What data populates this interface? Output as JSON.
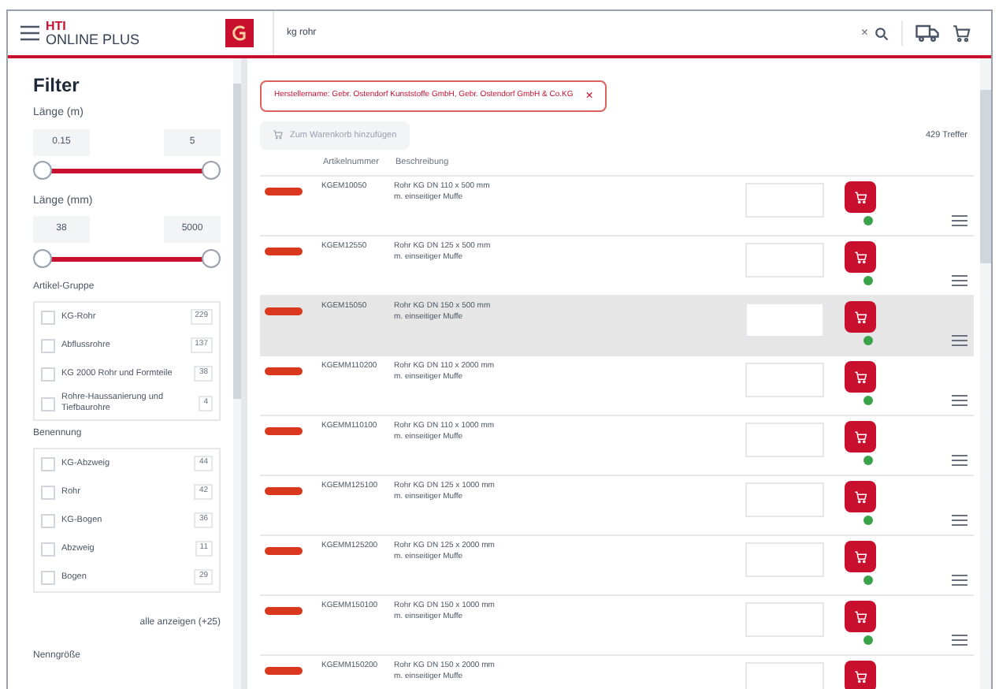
{
  "header": {
    "logo_top": "HTI",
    "logo_bottom": "ONLINE PLUS",
    "search_value": "kg rohr",
    "clear": "×"
  },
  "sidebar": {
    "title": "Filter",
    "ranges": [
      {
        "label": "Länge (m)",
        "min": "0.15",
        "max": "5",
        "level": 1
      },
      {
        "label": "Länge (mm)",
        "min": "38",
        "max": "5000",
        "level": 1
      }
    ],
    "groups": [
      {
        "title": "Artikel-Gruppe",
        "items": [
          {
            "label": "KG-Rohr",
            "count": "229",
            "checked": false
          },
          {
            "label": "Abflussrohre",
            "count": "137",
            "checked": false
          },
          {
            "label": "KG 2000 Rohr und Formteile",
            "count": "38",
            "checked": false
          },
          {
            "label": "Rohre-Haussanierung und Tiefbaurohre",
            "count": "4",
            "checked": false
          }
        ]
      },
      {
        "title": "Benennung",
        "items": [
          {
            "label": "KG-Abzweig",
            "count": "44",
            "checked": false
          },
          {
            "label": "Rohr",
            "count": "42",
            "checked": false
          },
          {
            "label": "KG-Bogen",
            "count": "36",
            "checked": false
          },
          {
            "label": "Abzweig",
            "count": "11",
            "checked": false
          },
          {
            "label": "Bogen",
            "count": "29",
            "checked": false
          }
        ],
        "more": "alle anzeigen (+25)"
      }
    ],
    "next_title": "Nenngröße"
  },
  "filter_chip": {
    "label": "Herstellername: Gebr. Ostendorf Kunststoffe GmbH, Gebr. Ostendorf GmbH & Co.KG",
    "remove": "×"
  },
  "add_to_cart": {
    "label": "Zum Warenkorb hinzufügen",
    "disabled": true
  },
  "hits": "429 Treffer",
  "table": {
    "columns": [
      "Artikelnummer",
      "Beschreibung"
    ],
    "rows": [
      {
        "number": "KGEM10050",
        "line1": "Rohr KG DN 110 x 500 mm",
        "line2": "m. einseitiger Muffe",
        "selected": false
      },
      {
        "number": "KGEM12550",
        "line1": "Rohr KG DN 125 x 500 mm",
        "line2": "m. einseitiger Muffe",
        "selected": false
      },
      {
        "number": "KGEM15050",
        "line1": "Rohr KG DN 150 x 500 mm",
        "line2": "m. einseitiger Muffe",
        "selected": true
      },
      {
        "number": "KGEMM110200",
        "line1": "Rohr KG DN 110 x 2000 mm",
        "line2": "m. einseitiger Muffe",
        "selected": false
      },
      {
        "number": "KGEMM110100",
        "line1": "Rohr KG DN 110 x 1000 mm",
        "line2": "m. einseitiger Muffe",
        "selected": false
      },
      {
        "number": "KGEMM125100",
        "line1": "Rohr KG DN 125 x 1000 mm",
        "line2": "m. einseitiger Muffe",
        "selected": false
      },
      {
        "number": "KGEMM125200",
        "line1": "Rohr KG DN 125 x 2000 mm",
        "line2": "m. einseitiger Muffe",
        "selected": false
      },
      {
        "number": "KGEMM150100",
        "line1": "Rohr KG DN 150 x 1000 mm",
        "line2": "m. einseitiger Muffe",
        "selected": false
      },
      {
        "number": "KGEMM150200",
        "line1": "Rohr KG DN 150 x 2000 mm",
        "line2": "m. einseitiger Muffe",
        "selected": false
      }
    ]
  }
}
